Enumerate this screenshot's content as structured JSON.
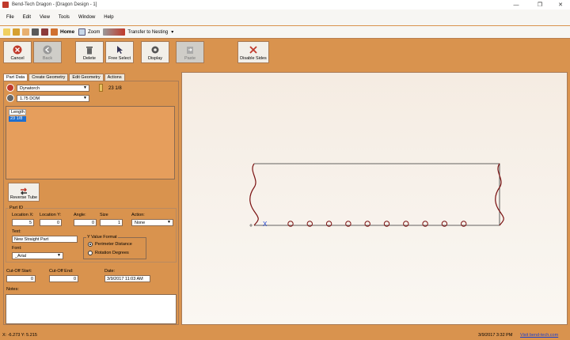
{
  "window": {
    "title": "Bend-Tech Dragon - [Dragon Design - 1]",
    "minimize": "—",
    "restore": "❐",
    "close": "✕"
  },
  "menu": [
    "File",
    "Edit",
    "View",
    "Tools",
    "Window",
    "Help"
  ],
  "quickbar": {
    "home": "Home",
    "zoom": "Zoom",
    "transfer": "Transfer to Nesting",
    "transfer_arrow": "▾"
  },
  "toolbar": {
    "cancel": "Cancel",
    "back": "Back",
    "delete": "Delete",
    "free_select": "Free Select",
    "display": "Display",
    "paste": "Paste",
    "disable_sides": "Disable Sides"
  },
  "tabs": [
    "Part Data",
    "Create Geometry",
    "Edit Geometry",
    "Actions"
  ],
  "part_data": {
    "material": "Dynatorch",
    "tube": "1.75 DOM",
    "length_display": "23 1/8",
    "list_header": "Length",
    "list_rows": [
      "23 1/8"
    ],
    "reverse_tube": "Reverse Tube"
  },
  "part_id": {
    "group_label": "Part ID",
    "loc_x_label": "Location X:",
    "loc_x": "5",
    "loc_y_label": "Location Y:",
    "loc_y": "0",
    "angle_label": "Angle:",
    "angle": "0",
    "size_label": "Size",
    "size": "1",
    "action_label": "Action:",
    "action": "None",
    "text_label": "Text:",
    "text": "New Straight Part",
    "font_label": "Font:",
    "font": "_Arial",
    "yformat_label": "Y Value Format",
    "yformat_options": [
      "Perimeter Distance",
      "Rotation Degrees"
    ],
    "yformat_selected": "Perimeter Distance"
  },
  "cutoff": {
    "start_label": "Cut-Off Start:",
    "start": "0",
    "end_label": "Cut-Off End:",
    "end": "0",
    "date_label": "Date:",
    "date": "3/9/2017 11:03 AM",
    "notes_label": "Notes:"
  },
  "drawing": {
    "marker": "X",
    "hole_count": 10
  },
  "status": {
    "coords": "X: -6.273  Y: 5.215",
    "datetime": "3/9/2017   3:32 PM",
    "link": "Visit bend-tech.com"
  }
}
